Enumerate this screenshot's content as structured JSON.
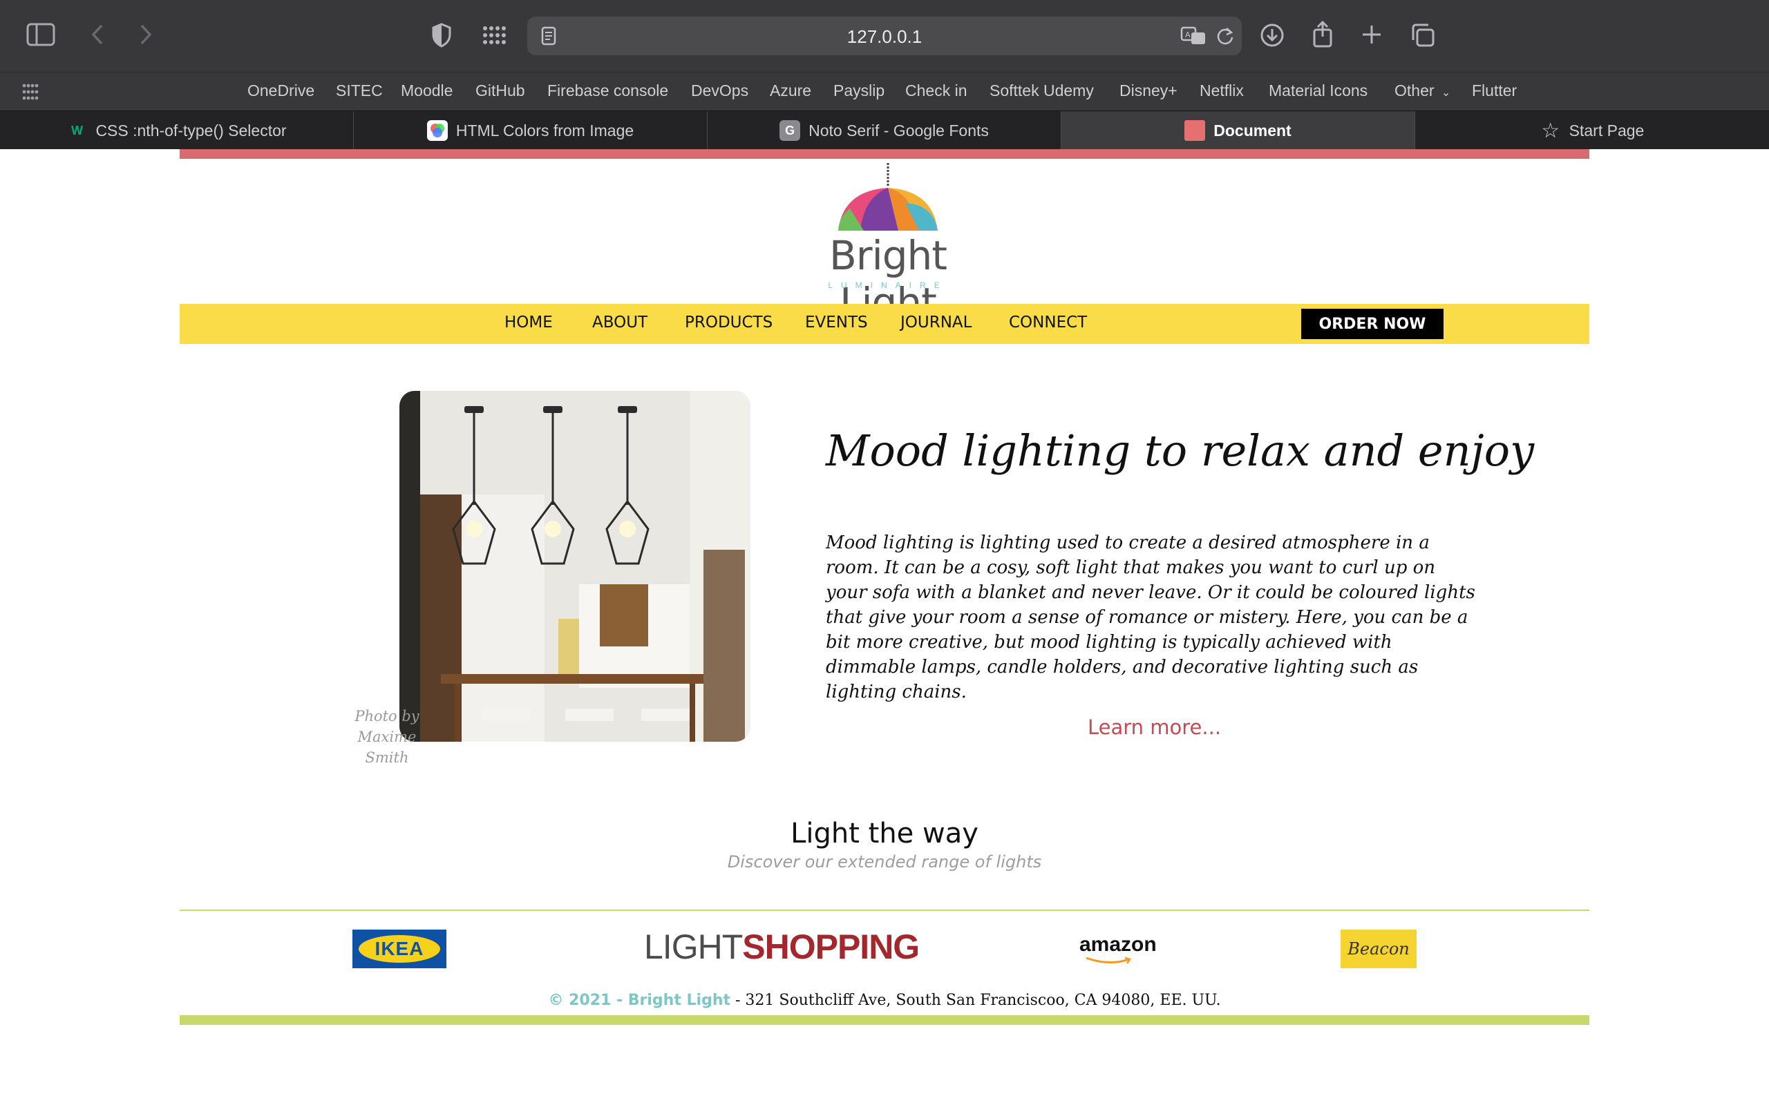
{
  "browser": {
    "url": "127.0.0.1",
    "favorites": [
      "OneDrive",
      "SITEC",
      "Moodle",
      "GitHub",
      "Firebase console",
      "DevOps",
      "Azure",
      "Payslip",
      "Check in",
      "Softtek Udemy",
      "Disney+",
      "Netflix",
      "Material Icons",
      "Other",
      "Flutter"
    ],
    "tabs": [
      {
        "label": "CSS :nth-of-type() Selector",
        "icon": "w3schools-icon"
      },
      {
        "label": "HTML Colors from Image",
        "icon": "color-wheel-icon"
      },
      {
        "label": "Noto Serif - Google Fonts",
        "icon": "google-icon"
      },
      {
        "label": "Document",
        "icon": "document-favicon"
      },
      {
        "label": "Start Page",
        "icon": "star-icon"
      }
    ]
  },
  "site": {
    "brand": "Bright Light",
    "brand_sub": "LUMINAIRE",
    "nav": [
      "HOME",
      "ABOUT",
      "PRODUCTS",
      "EVENTS",
      "JOURNAL",
      "CONNECT"
    ],
    "order_button": "ORDER NOW",
    "photo_credit": "Photo by Maxime Smith",
    "hero_title": "Mood lighting to relax and enjoy",
    "hero_text": "Mood lighting is lighting used to create a desired atmosphere in a room. It can be a cosy, soft light that makes you want to curl up on your sofa with a blanket and never leave. Or it could be coloured lights that give your room a sense of romance or mistery. Here, you can be a bit more creative, but mood lighting is typically achieved with dimmable lamps, candle holders, and decorative lighting such as lighting chains.",
    "learn_more": "Learn more...",
    "section_title": "Light the way",
    "section_sub": "Discover our extended range of lights",
    "brands": {
      "ikea": "IKEA",
      "lightshopping_a": "LIGHT",
      "lightshopping_b": "SHOPPING",
      "amazon": "amazon",
      "beacon": "Beacon"
    },
    "footer_copy": "© 2021 - Bright Light",
    "footer_address": " - 321 Southcliff Ave, South San Franciscoo, CA 94080, EE. UU."
  },
  "colors": {
    "accent_red": "#d96a6e",
    "nav_yellow": "#f9dc48",
    "accent_green": "#c9d86a",
    "teal": "#7dc7c4"
  }
}
